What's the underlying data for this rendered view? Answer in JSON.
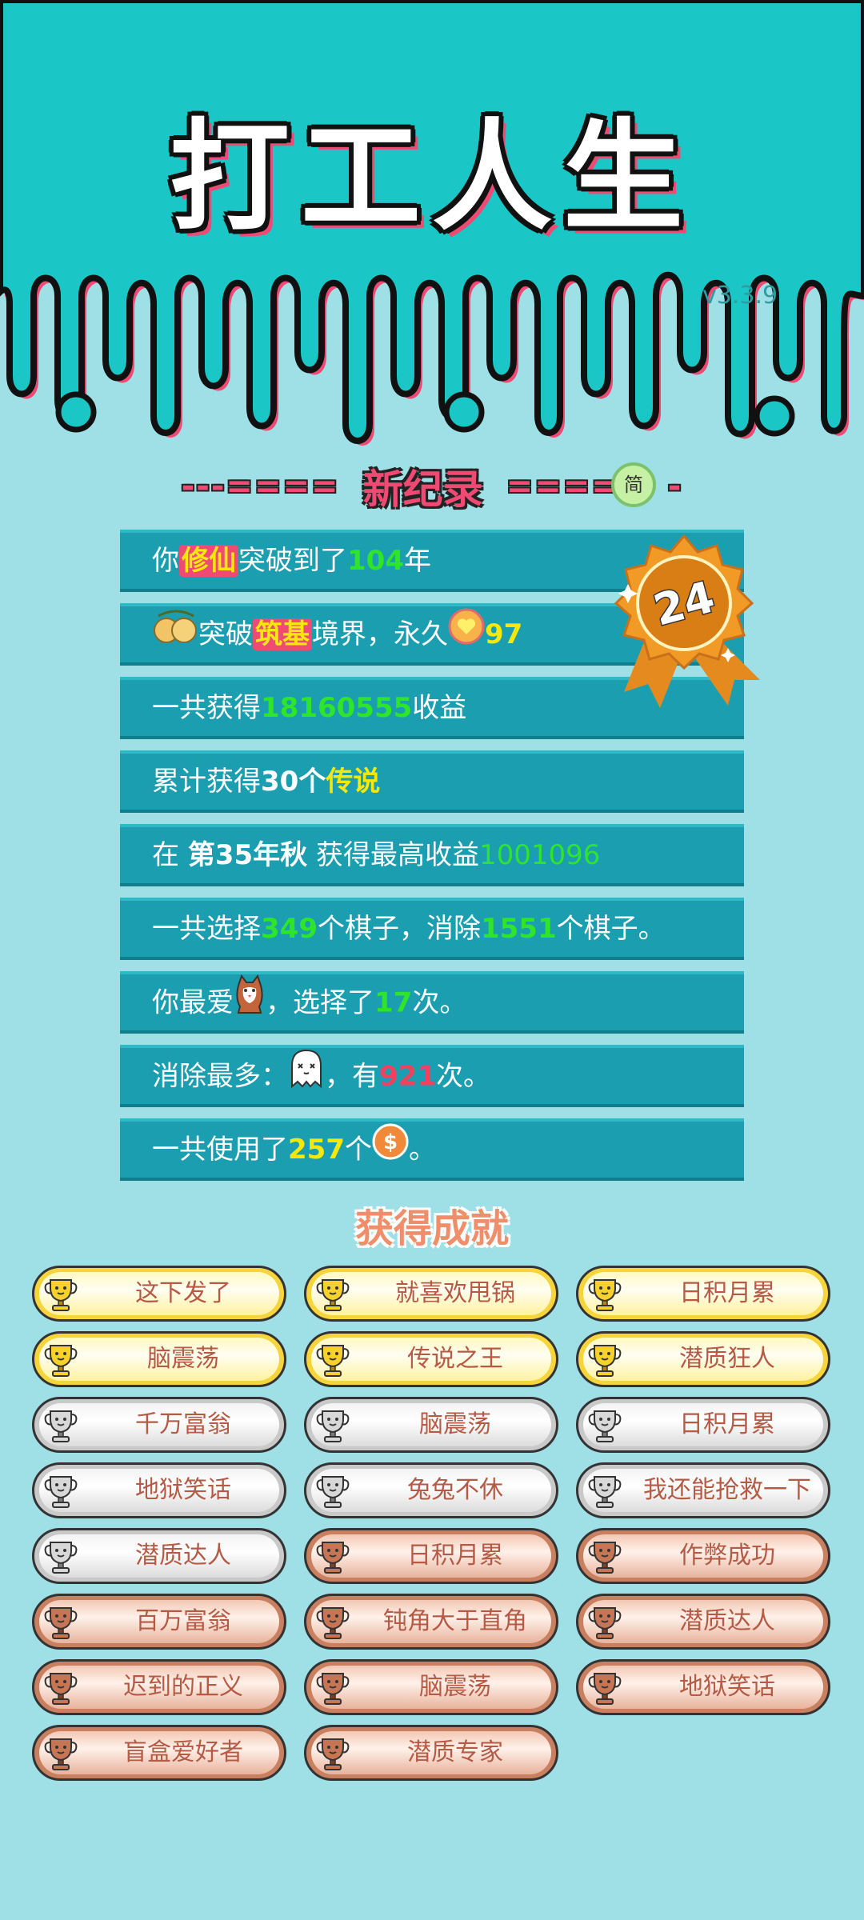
{
  "header": {
    "title": "打工人生",
    "version": "v3.3.9"
  },
  "record": {
    "title": "新纪录",
    "dash_left": "---====",
    "dash_right": "====",
    "dash_tail": "-",
    "simp_label": "简",
    "medal_number": "24"
  },
  "records": [
    {
      "p1": "你",
      "p2": "修仙",
      "p3": "突破到了",
      "p4": "104",
      "p5": "年"
    },
    {
      "p1": "突破",
      "p2": "筑基",
      "p3": "境界，永久",
      "p4": "97"
    },
    {
      "p1": "一共获得",
      "p2": "18160555",
      "p3": "收益"
    },
    {
      "p1": "累计获得",
      "p2": "30个",
      "p3": "传说"
    },
    {
      "p1": "在 ",
      "p2": "第35年秋",
      "p3": " 获得最高收益",
      "p4": "1001096"
    },
    {
      "p1": "一共选择",
      "p2": "349",
      "p3": "个棋子，消除",
      "p4": "1551",
      "p5": "个棋子。"
    },
    {
      "p1": "你最爱",
      "p2": "，选择了",
      "p3": "17",
      "p4": "次。"
    },
    {
      "p1": "消除最多：",
      "p2": "，有",
      "p3": "921",
      "p4": "次。"
    },
    {
      "p1": "一共使用了",
      "p2": "257",
      "p3": "个",
      "p4": "。"
    }
  ],
  "achievements_title": "获得成就",
  "achievements": [
    {
      "label": "这下发了",
      "tier": "gold"
    },
    {
      "label": "就喜欢甩锅",
      "tier": "gold"
    },
    {
      "label": "日积月累",
      "tier": "gold"
    },
    {
      "label": "脑震荡",
      "tier": "gold"
    },
    {
      "label": "传说之王",
      "tier": "gold"
    },
    {
      "label": "潜质狂人",
      "tier": "gold"
    },
    {
      "label": "千万富翁",
      "tier": "silver"
    },
    {
      "label": "脑震荡",
      "tier": "silver"
    },
    {
      "label": "日积月累",
      "tier": "silver"
    },
    {
      "label": "地狱笑话",
      "tier": "silver"
    },
    {
      "label": "兔兔不休",
      "tier": "silver"
    },
    {
      "label": "我还能抢救一下",
      "tier": "silver"
    },
    {
      "label": "潜质达人",
      "tier": "silver"
    },
    {
      "label": "日积月累",
      "tier": "bronze"
    },
    {
      "label": "作弊成功",
      "tier": "bronze"
    },
    {
      "label": "百万富翁",
      "tier": "bronze"
    },
    {
      "label": "钝角大于直角",
      "tier": "bronze"
    },
    {
      "label": "潜质达人",
      "tier": "bronze"
    },
    {
      "label": "迟到的正义",
      "tier": "bronze"
    },
    {
      "label": "脑震荡",
      "tier": "bronze"
    },
    {
      "label": "地狱笑话",
      "tier": "bronze"
    },
    {
      "label": "盲盒爱好者",
      "tier": "bronze"
    },
    {
      "label": "潜质专家",
      "tier": "bronze"
    }
  ],
  "colors": {
    "teal": "#1ac6c6",
    "bg": "#9fdfe6",
    "pink": "#ef4a74",
    "yellow": "#f6e80d",
    "green": "#2fe52b",
    "red": "#f2415e",
    "row": "#1a9eb0"
  }
}
